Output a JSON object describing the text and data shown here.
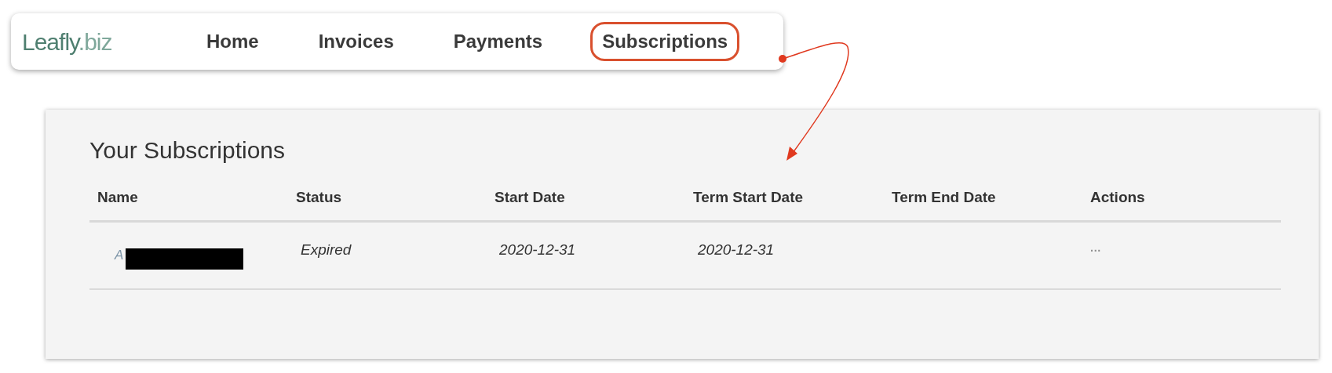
{
  "logo": {
    "name": "Leafly",
    "suffix": ".biz"
  },
  "nav": [
    {
      "label": "Home",
      "circled": false
    },
    {
      "label": "Invoices",
      "circled": false
    },
    {
      "label": "Payments",
      "circled": false
    },
    {
      "label": "Subscriptions",
      "circled": true
    }
  ],
  "panel": {
    "title": "Your Subscriptions",
    "columns": [
      "Name",
      "Status",
      "Start Date",
      "Term Start Date",
      "Term End Date",
      "Actions"
    ],
    "rows": [
      {
        "name": "A",
        "redacted": true,
        "status": "Expired",
        "start_date": "2020-12-31",
        "term_start_date": "2020-12-31",
        "actions": "···"
      }
    ]
  }
}
